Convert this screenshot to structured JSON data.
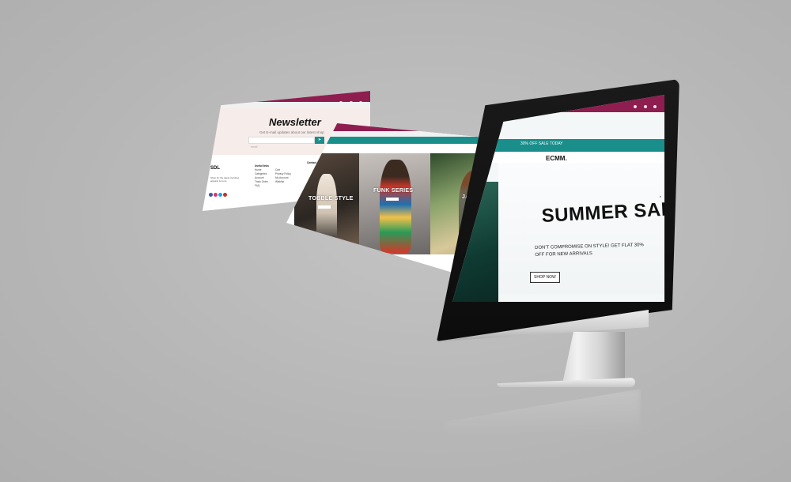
{
  "newsletter_window": {
    "title": "Newsletter",
    "hint": "Get E-mail updates about our latest shop",
    "input_placeholder": "email",
    "send_icon": "send-arrow-icon",
    "footer_logo": "SDL",
    "footer_text": "Shop for the latest trending apparel & more",
    "columns": [
      {
        "heading": "Useful links",
        "items": [
          "Home",
          "Categories",
          "Account",
          "Track Order",
          "FAQ"
        ]
      },
      {
        "heading": "",
        "items": [
          "Cart",
          "Privacy Policy",
          "My Account",
          "Wishlist"
        ]
      },
      {
        "heading": "Contact",
        "items": []
      }
    ],
    "social_colors": [
      "#3b5998",
      "#e1306c",
      "#1da1f2",
      "#c4302b"
    ]
  },
  "fashion_window": {
    "captions": [
      "TOBBLE STYLE",
      "FUNK SERIES",
      "JACKETS!"
    ]
  },
  "desktop": {
    "promo": "30% OFF SALE TODAY",
    "brand": "ECMM.",
    "hero_title": "SUMMER SALE",
    "hero_subtitle": "DON'T COMPROMISE ON STYLE! GET FLAT 30% OFF FOR NEW ARRIVALS",
    "cta_label": "SHOP NOW",
    "colors": {
      "accent": "#8e1e4f",
      "teal": "#1a8e8a"
    }
  }
}
